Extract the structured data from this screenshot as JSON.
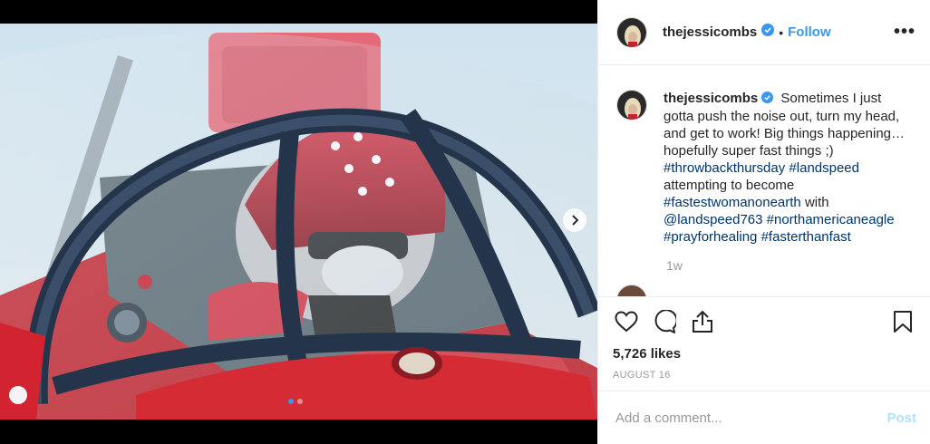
{
  "post": {
    "username": "thejessicombs",
    "separator": "•",
    "follow_label": "Follow",
    "more_label": "•••",
    "caption_parts": {
      "text1": "Sometimes I just gotta push the noise out, turn my head, and get to work! Big things happening… hopefully super fast things ;)",
      "tag1": "#throwbackthursday",
      "tag2": "#landspeed",
      "text2": "attempting to become",
      "tag3": "#fastestwomanonearth",
      "text3": "with",
      "tag4": "@landspeed763",
      "tag5": "#northamericaneagle",
      "tag6": "#prayforhealing",
      "tag7": "#fasterthanfast"
    },
    "time_ago": "1w",
    "next_comment_partial": "...",
    "likes": "5,726 likes",
    "date": "AUGUST 16",
    "comment_placeholder": "Add a comment...",
    "post_label": "Post"
  },
  "media": {
    "slide_count": 2,
    "active_slide": 1
  },
  "icons": {
    "verified": "verified-badge-icon",
    "heart": "heart-icon",
    "comment": "comment-icon",
    "share": "share-icon",
    "bookmark": "bookmark-icon",
    "next": "chevron-right-icon"
  },
  "colors": {
    "link": "#3897f0",
    "hashtag": "#003569",
    "muted": "#999999",
    "post_disabled": "#b2dffc"
  }
}
